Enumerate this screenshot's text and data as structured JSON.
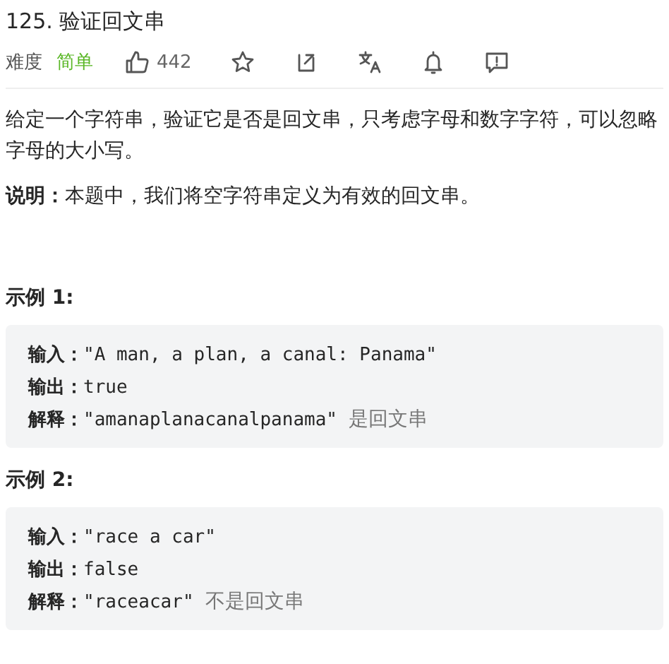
{
  "title": "125. 验证回文串",
  "meta": {
    "difficulty_label": "难度",
    "difficulty": "简单",
    "likes": "442"
  },
  "toolbar": [
    {
      "kind": "star"
    },
    {
      "kind": "share"
    },
    {
      "kind": "translate"
    },
    {
      "kind": "bell"
    },
    {
      "kind": "feedback"
    }
  ],
  "description": "给定一个字符串，验证它是否是回文串，只考虑字母和数字字符，可以忽略字母的大小写。",
  "note": "**说明：**本题中，我们将空字符串定义为有效的回文串。",
  "examples": [
    {
      "heading": "示例 1:",
      "lines": [
        {
          "label": "输入：",
          "value": "\"A man, a plan, a canal: Panama\""
        },
        {
          "label": "输出：",
          "value": "true"
        },
        {
          "label": "解释：",
          "value": "\"amanaplanacanalpanama\"",
          "note": "是回文串"
        }
      ]
    },
    {
      "heading": "示例 2:",
      "lines": [
        {
          "label": "输入：",
          "value": "\"race a car\""
        },
        {
          "label": "输出：",
          "value": "false"
        },
        {
          "label": "解释：",
          "value": "\"raceacar\"",
          "note": "不是回文串"
        }
      ]
    }
  ]
}
